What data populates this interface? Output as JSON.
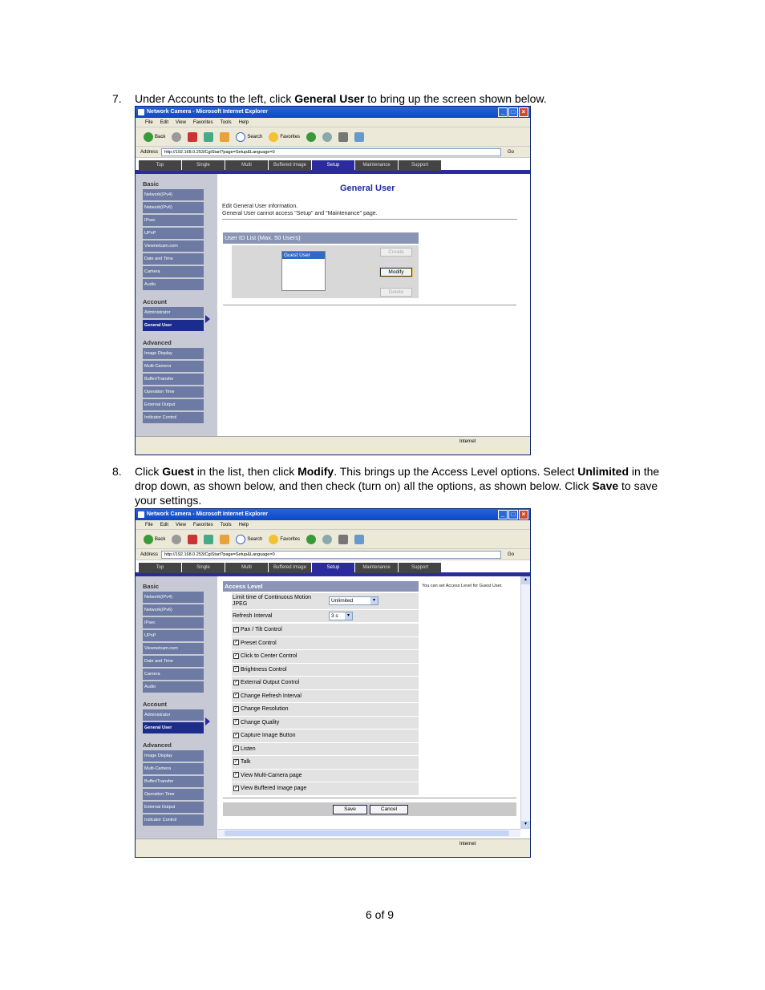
{
  "step7": {
    "num": "7.",
    "pre": "Under Accounts to the left, click ",
    "bold": "General User",
    "post": " to bring up the screen shown below."
  },
  "step8": {
    "num": "8.",
    "p1": "Click ",
    "b1": "Guest",
    "p2": " in the list, then click ",
    "b2": "Modify",
    "p3": ".  This brings up the Access Level options. Select ",
    "b3": "Unlimited",
    "p4": " in the drop down, as shown below, and then check (turn on) all the options, as shown below.  Click ",
    "b4": "Save",
    "p5": " to save your settings."
  },
  "browser": {
    "title": "Network Camera - Microsoft Internet Explorer",
    "menu": [
      "File",
      "Edit",
      "View",
      "Favorites",
      "Tools",
      "Help"
    ],
    "back": "Back",
    "search": "Search",
    "favorites": "Favorites",
    "address_label": "Address",
    "url": "http://192.168.0.253/CgiStart?page=Setup&Language=0",
    "go": "Go",
    "status": "Internet"
  },
  "tabs": [
    "Top",
    "Single",
    "Multi",
    "Buffered Image",
    "Setup",
    "Maintenance",
    "Support"
  ],
  "sidebar": {
    "basic_head": "Basic",
    "basic": [
      "Network(IPv4)",
      "Network(IPv6)",
      "IPsec",
      "UPnP",
      "Viewnetcam.com",
      "Date and Time",
      "Camera",
      "Audio"
    ],
    "account_head": "Account",
    "account": [
      "Administrator",
      "General User"
    ],
    "advanced_head": "Advanced",
    "advanced": [
      "Image Display",
      "Multi-Camera",
      "Buffer/Transfer",
      "Operation Time",
      "External Output",
      "Indicator Control"
    ]
  },
  "screen1": {
    "heading": "General User",
    "desc1": "Edit General User information.",
    "desc2": "General User cannot access \"Setup\" and \"Maintenance\" page.",
    "list_title": "User ID List (Max. 50 Users)",
    "list_item": "Guest User",
    "create": "Create",
    "modify": "Modify",
    "delete": "Delete"
  },
  "screen2": {
    "title": "Access Level",
    "hint": "You can set Access Level for Guest User.",
    "limit_label": "Limit time of Continuous Motion JPEG",
    "limit_value": "Unlimited",
    "refresh_label": "Refresh Interval",
    "refresh_value": "3 s",
    "options": [
      "Pan / Tilt Control",
      "Preset Control",
      "Click to Center Control",
      "Brightness Control",
      "External Output Control",
      "Change Refresh Interval",
      "Change Resolution",
      "Change Quality",
      "Capture Image Button",
      "Listen",
      "Talk",
      "View Multi-Camera page",
      "View Buffered Image page"
    ],
    "save": "Save",
    "cancel": "Cancel"
  },
  "footer": "6 of 9"
}
